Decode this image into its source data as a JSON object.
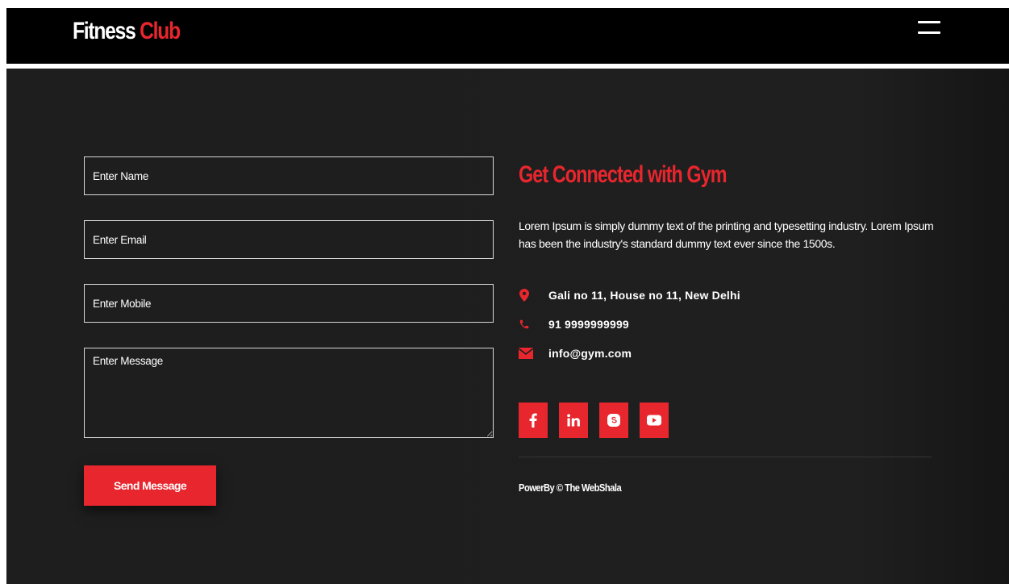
{
  "header": {
    "brand_word1": "Fitness",
    "brand_word2": "Club",
    "menu_icon": "hamburger-menu-icon"
  },
  "form": {
    "name_placeholder": "Enter Name",
    "email_placeholder": "Enter Email",
    "mobile_placeholder": "Enter Mobile",
    "message_placeholder": "Enter Message",
    "send_label": "Send Message"
  },
  "contact": {
    "heading": "Get Connected with Gym",
    "description": "Lorem Ipsum is simply dummy text of the printing and typesetting industry. Lorem Ipsum has been the industry's standard dummy text ever since the 1500s.",
    "address": "Gali no 11, House no 11, New Delhi",
    "phone": "91 9999999999",
    "email": "info@gym.com",
    "address_icon": "map-pin-icon",
    "phone_icon": "phone-icon",
    "email_icon": "envelope-icon"
  },
  "social": [
    "facebook-icon",
    "linkedin-icon",
    "skype-icon",
    "youtube-icon"
  ],
  "footer": {
    "powered_by": "PowerBy © The WebShala"
  },
  "colors": {
    "accent": "#e8262d",
    "background": "#1e1e1e",
    "navbar": "#000000",
    "text": "#ffffff"
  }
}
